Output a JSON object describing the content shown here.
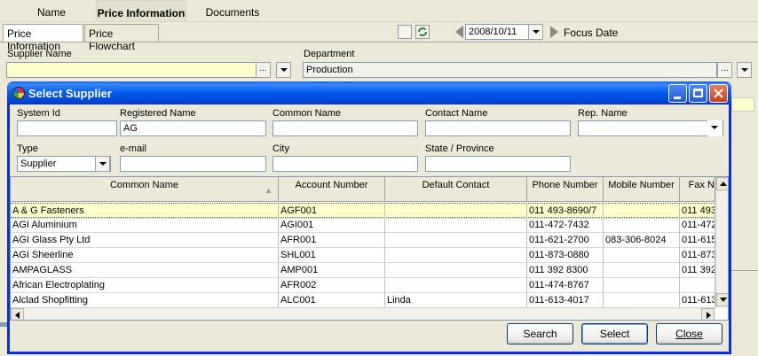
{
  "top_tabs": [
    "Name",
    "Price Information",
    "Documents"
  ],
  "sub_tabs": [
    "Price Information",
    "Price Flowchart"
  ],
  "date": {
    "value": "2008/10/11",
    "focus_label": "Focus Date"
  },
  "main": {
    "supplier_label": "Supplier Name",
    "supplier_value": "",
    "ellipsis": "...",
    "department_label": "Department",
    "department_value": "Production"
  },
  "dialog": {
    "title": "Select Supplier",
    "filters": {
      "system_id_label": "System Id",
      "system_id_value": "",
      "registered_name_label": "Registered Name",
      "registered_name_value": "AG",
      "common_name_label": "Common Name",
      "common_name_value": "",
      "contact_name_label": "Contact Name",
      "contact_name_value": "",
      "rep_name_label": "Rep. Name",
      "rep_name_value": "",
      "type_label": "Type",
      "type_value": "Supplier",
      "email_label": "e-mail",
      "email_value": "",
      "city_label": "City",
      "city_value": "",
      "state_label": "State / Province",
      "state_value": ""
    },
    "columns": [
      "Common Name",
      "Account Number",
      "Default Contact",
      "Phone Number",
      "Mobile Number",
      "Fax N"
    ],
    "rows": [
      [
        "A & G Fasteners",
        "AGF001",
        "",
        "011 493-8690/7",
        "",
        "011 493"
      ],
      [
        "AGI Aluminium",
        "AGI001",
        "",
        "011-472-7432",
        "",
        "011-472"
      ],
      [
        "AGI Glass Pty Ltd",
        "AFR001",
        "",
        "011-621-2700",
        "083-306-8024",
        "011-615"
      ],
      [
        "AGI Sheerline",
        "SHL001",
        "",
        "011-873-0880",
        "",
        "011-873"
      ],
      [
        "AMPAGLASS",
        "AMP001",
        "",
        "011 392 8300",
        "",
        "011 392"
      ],
      [
        "African Electroplating",
        "AFR002",
        "",
        "011-474-8767",
        "",
        ""
      ],
      [
        "Alclad Shopfitting",
        "ALC001",
        "Linda",
        "011-613-4017",
        "",
        "011-613"
      ]
    ],
    "buttons": {
      "search": "Search",
      "select": "Select",
      "close": "Close"
    }
  }
}
